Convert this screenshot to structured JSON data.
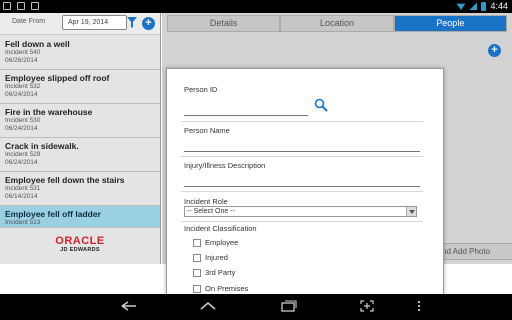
{
  "status_bar": {
    "time": "4:44"
  },
  "filter": {
    "label": "Date From",
    "date_value": "Apr 19, 2014"
  },
  "incidents": [
    {
      "title": "Fell down a well",
      "number": "Incident 540",
      "date": "06/26/2014"
    },
    {
      "title": "Employee slipped off roof",
      "number": "Incident 532",
      "date": "06/24/2014"
    },
    {
      "title": "Fire in the warehouse",
      "number": "Incident 530",
      "date": "06/24/2014"
    },
    {
      "title": "Crack in sidewalk.",
      "number": "Incident 528",
      "date": "06/24/2014"
    },
    {
      "title": "Employee fell down the stairs",
      "number": "Incident 531",
      "date": "06/14/2014"
    },
    {
      "title": "Employee fell off ladder",
      "number": "Incident 513",
      "date": ""
    }
  ],
  "logo": {
    "oracle": "ORACLE",
    "jde": "JD EDWARDS"
  },
  "tabs": [
    "Details",
    "Location",
    "People"
  ],
  "active_tab": "People",
  "add_photo_label": "nd Add Photo",
  "form": {
    "person_id_label": "Person ID",
    "person_name_label": "Person Name",
    "injury_label": "Injury/Illness Description",
    "incident_role_label": "Incident Role",
    "incident_role_value": "-- Select One --",
    "classification_label": "Incident Classification",
    "classifications": [
      "Employee",
      "Injured",
      "3rd Party",
      "On Premises"
    ]
  },
  "colors": {
    "accent": "#1b73c8",
    "selected_row": "#9ad0e3",
    "oracle_red": "#d0222c"
  }
}
